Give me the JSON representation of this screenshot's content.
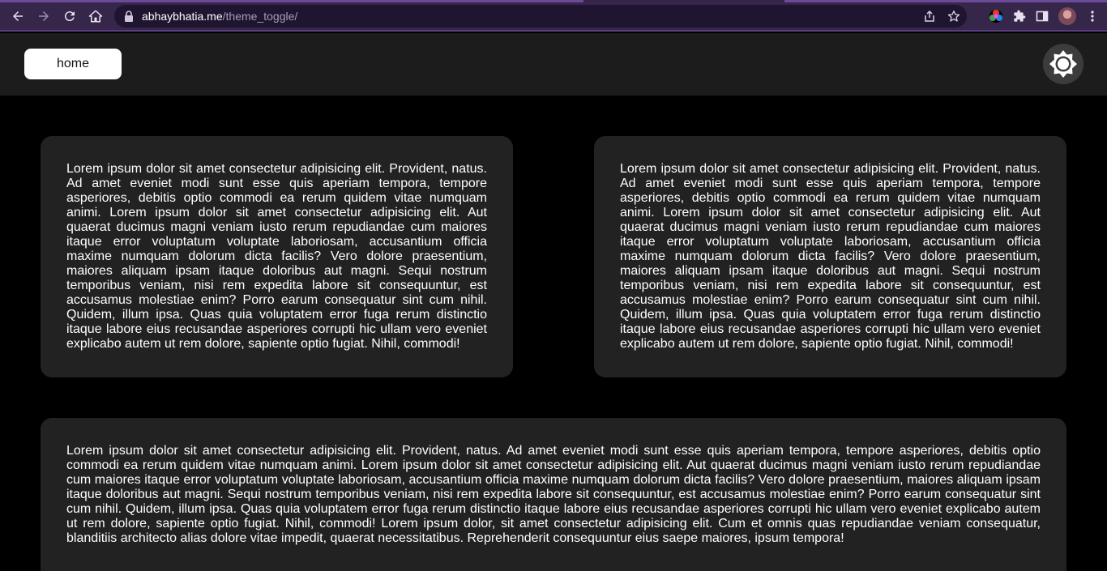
{
  "browser": {
    "url_host": "abhaybhatia.me",
    "url_path": "/theme_toggle/",
    "icons": [
      "back-arrow-icon",
      "forward-arrow-icon",
      "reload-icon",
      "home-icon",
      "lock-icon",
      "share-icon",
      "star-icon",
      "color-extension-icon",
      "puzzle-icon",
      "side-panel-icon",
      "avatar",
      "more-vert-icon"
    ]
  },
  "header": {
    "home_label": "home",
    "toggle_icon": "sun-icon"
  },
  "cards": {
    "left": "Lorem ipsum dolor sit amet consectetur adipisicing elit. Provident, natus. Ad amet eveniet modi sunt esse quis aperiam tempora, tempore asperiores, debitis optio commodi ea rerum quidem vitae numquam animi. Lorem ipsum dolor sit amet consectetur adipisicing elit. Aut quaerat ducimus magni veniam iusto rerum repudiandae cum maiores itaque error voluptatum voluptate laboriosam, accusantium officia maxime numquam dolorum dicta facilis? Vero dolore praesentium, maiores aliquam ipsam itaque doloribus aut magni. Sequi nostrum temporibus veniam, nisi rem expedita labore sit consequuntur, est accusamus molestiae enim? Porro earum consequatur sint cum nihil. Quidem, illum ipsa. Quas quia voluptatem error fuga rerum distinctio itaque labore eius recusandae asperiores corrupti hic ullam vero eveniet explicabo autem ut rem dolore, sapiente optio fugiat. Nihil, commodi!",
    "right": "Lorem ipsum dolor sit amet consectetur adipisicing elit. Provident, natus. Ad amet eveniet modi sunt esse quis aperiam tempora, tempore asperiores, debitis optio commodi ea rerum quidem vitae numquam animi. Lorem ipsum dolor sit amet consectetur adipisicing elit. Aut quaerat ducimus magni veniam iusto rerum repudiandae cum maiores itaque error voluptatum voluptate laboriosam, accusantium officia maxime numquam dolorum dicta facilis? Vero dolore praesentium, maiores aliquam ipsam itaque doloribus aut magni. Sequi nostrum temporibus veniam, nisi rem expedita labore sit consequuntur, est accusamus molestiae enim? Porro earum consequatur sint cum nihil. Quidem, illum ipsa. Quas quia voluptatem error fuga rerum distinctio itaque labore eius recusandae asperiores corrupti hic ullam vero eveniet explicabo autem ut rem dolore, sapiente optio fugiat. Nihil, commodi!",
    "wide": "Lorem ipsum dolor sit amet consectetur adipisicing elit. Provident, natus. Ad amet eveniet modi sunt esse quis aperiam tempora, tempore asperiores, debitis optio commodi ea rerum quidem vitae numquam animi. Lorem ipsum dolor sit amet consectetur adipisicing elit. Aut quaerat ducimus magni veniam iusto rerum repudiandae cum maiores itaque error voluptatum voluptate laboriosam, accusantium officia maxime numquam dolorum dicta facilis? Vero dolore praesentium, maiores aliquam ipsam itaque doloribus aut magni. Sequi nostrum temporibus veniam, nisi rem expedita labore sit consequuntur, est accusamus molestiae enim? Porro earum consequatur sint cum nihil. Quidem, illum ipsa. Quas quia voluptatem error fuga rerum distinctio itaque labore eius recusandae asperiores corrupti hic ullam vero eveniet explicabo autem ut rem dolore, sapiente optio fugiat. Nihil, commodi! Lorem ipsum dolor, sit amet consectetur adipisicing elit. Cum et omnis quas repudiandae veniam consequatur, blanditiis architecto alias dolore vitae impedit, quaerat necessitatibus. Reprehenderit consequuntur eius saepe maiores, ipsum tempora!"
  },
  "colors": {
    "page_background": "#000000",
    "header_background": "#1c1c1c",
    "card_background": "#222222",
    "browser_frame": "#35264a"
  }
}
